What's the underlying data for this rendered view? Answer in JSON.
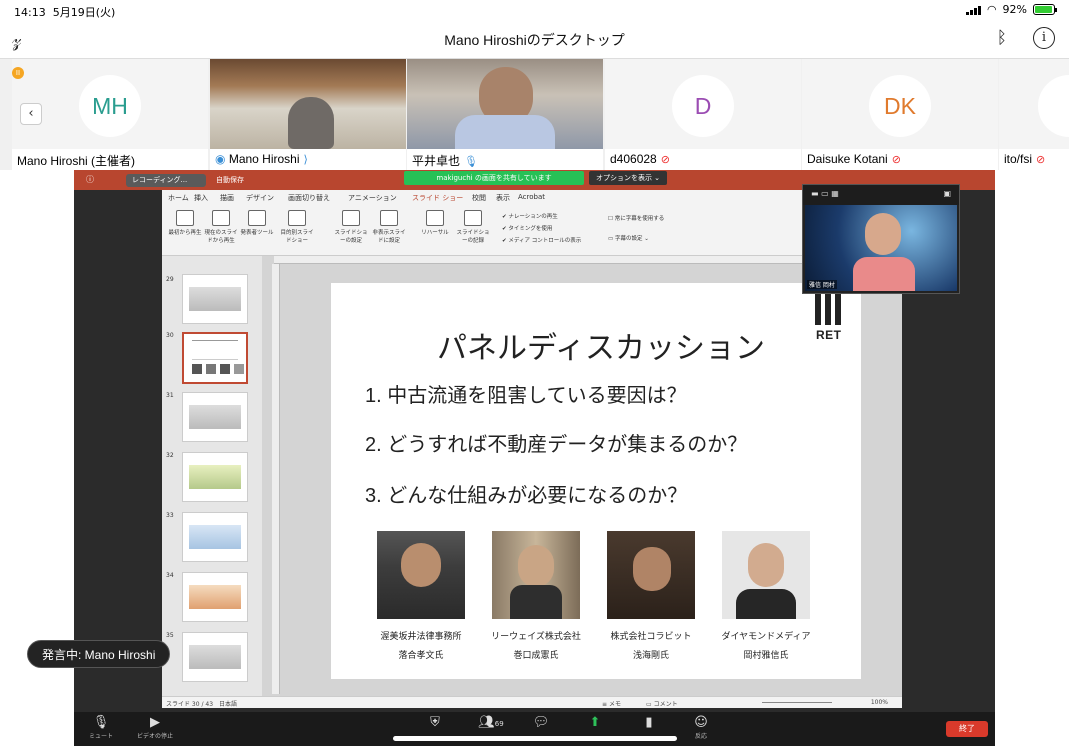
{
  "status_bar": {
    "time": "14:13",
    "date": "5月19日(火)",
    "battery": "92%",
    "battery_level": 0.92
  },
  "header": {
    "title": "Mano Hiroshiのデスクトップ"
  },
  "participants": [
    {
      "initials": "MH",
      "name": "Mano Hiroshi (主催者)",
      "mic": "",
      "initials_color": "#2a9d8f"
    },
    {
      "initials": "",
      "name": "Mano Hiroshi",
      "mic": "on",
      "initials_color": ""
    },
    {
      "initials": "",
      "name": "平井卓也",
      "mic": "on",
      "initials_color": ""
    },
    {
      "initials": "D",
      "name": "d406028",
      "mic": "off",
      "initials_color": "#9b4db3"
    },
    {
      "initials": "DK",
      "name": "Daisuke Kotani",
      "mic": "off",
      "initials_color": "#e07a2d"
    },
    {
      "initials": "",
      "name": "ito/fsi",
      "mic": "off",
      "initials_color": ""
    }
  ],
  "ppt": {
    "recording_label": "レコーディング...",
    "autosave": "自動保存",
    "share_banner": "makiguchi の画面を共有しています",
    "options": "オプションを表示 ⌄",
    "tabs": [
      "ホーム",
      "挿入",
      "描画",
      "デザイン",
      "画面切り替え",
      "アニメーション",
      "スライド ショー",
      "校閲",
      "表示",
      "Acrobat"
    ],
    "active_tab": "スライド ショー",
    "ribbon": [
      "最初から再生",
      "現在のスライドから再生",
      "発表者ツール",
      "目的別スライドショー",
      "スライドショーの設定",
      "非表示スライドに設定",
      "リハーサル",
      "スライドショーの記録"
    ],
    "checkboxes": [
      "ナレーションの再生",
      "タイミングを使用",
      "メディア コントロールの表示"
    ],
    "caption_option": "常に字幕を使用する",
    "caption_settings": "字幕の設定",
    "slide_numbers": [
      "29",
      "30",
      "31",
      "32",
      "33",
      "34",
      "35"
    ],
    "status": "スライド 30 / 43　日本語",
    "notes": "メモ",
    "comments": "コメント",
    "zoom": "100%"
  },
  "slide": {
    "title": "パネルディスカッション",
    "questions": [
      "1. 中古流通を阻害している要因は？",
      "2. どうすれば不動産データが集まるのか？",
      "3. どんな仕組みが必要になるのか？"
    ],
    "logo_text": "RET",
    "panelists": [
      {
        "org": "渥美坂井法律事務所",
        "name": "落合孝文氏"
      },
      {
        "org": "リーウェイズ株式会社",
        "name": "巻口成憲氏"
      },
      {
        "org": "株式会社コラビット",
        "name": "浅海剛氏"
      },
      {
        "org": "ダイヤモンドメディア",
        "name": "岡村雅信氏"
      }
    ]
  },
  "pip": {
    "label": "雅信 岡村"
  },
  "speaking": "発言中: Mano Hiroshi",
  "toolbar": {
    "mute": "ミュート",
    "video": "ビデオの停止",
    "participants_count": "69",
    "reactions": "反応",
    "end": "終了"
  }
}
